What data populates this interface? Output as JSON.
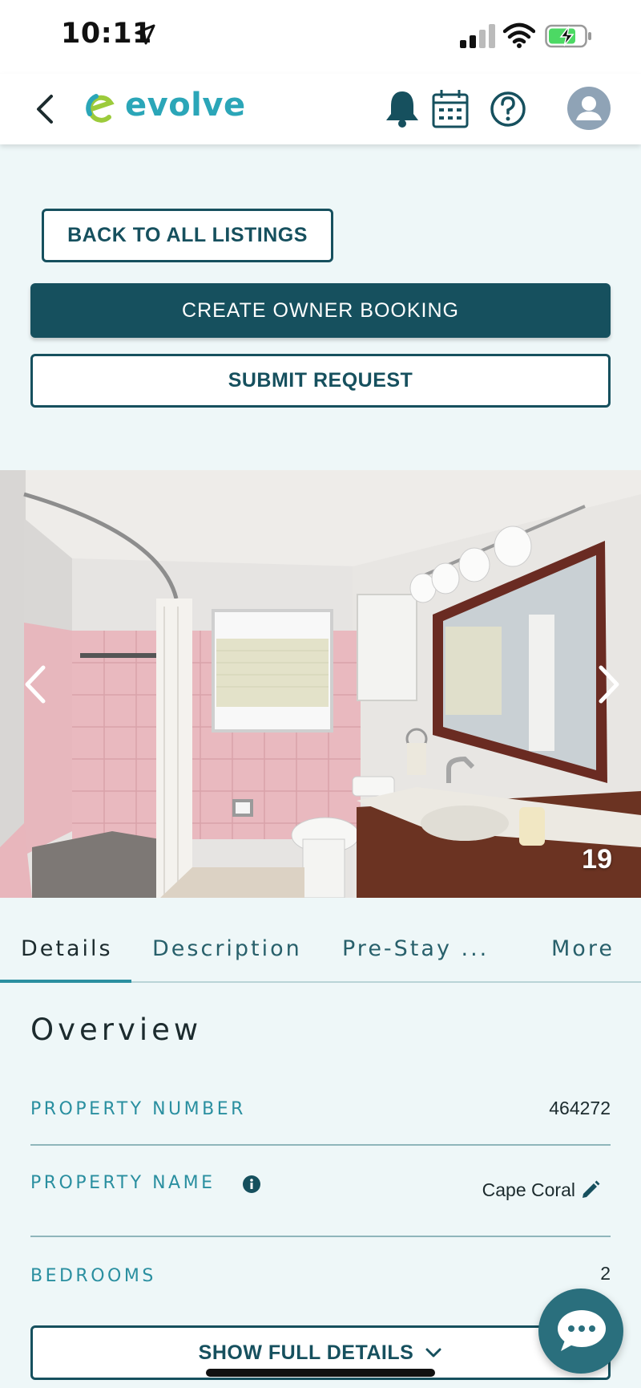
{
  "status_bar": {
    "time": "10:11"
  },
  "header": {
    "logo_text": "evolve"
  },
  "actions": {
    "back_label": "BACK TO ALL LISTINGS",
    "create_label": "CREATE OWNER BOOKING",
    "submit_label": "SUBMIT REQUEST"
  },
  "gallery": {
    "photo_number": "19"
  },
  "tabs": [
    {
      "label": "Details",
      "active": true
    },
    {
      "label": "Description"
    },
    {
      "label": "Pre-Stay ..."
    },
    {
      "label": "More"
    }
  ],
  "overview": {
    "title": "Overview",
    "rows": [
      {
        "label": "PROPERTY NUMBER",
        "value": "464272"
      },
      {
        "label": "PROPERTY NAME",
        "value": "Cape Coral"
      },
      {
        "label": "BEDROOMS",
        "value": "2"
      }
    ]
  },
  "show_full_label": "SHOW FULL DETAILS",
  "colors": {
    "brand": "#16505e",
    "accent": "#2a8fa0",
    "logo": "#2ba6b8",
    "logo_green": "#9ccb3b"
  }
}
